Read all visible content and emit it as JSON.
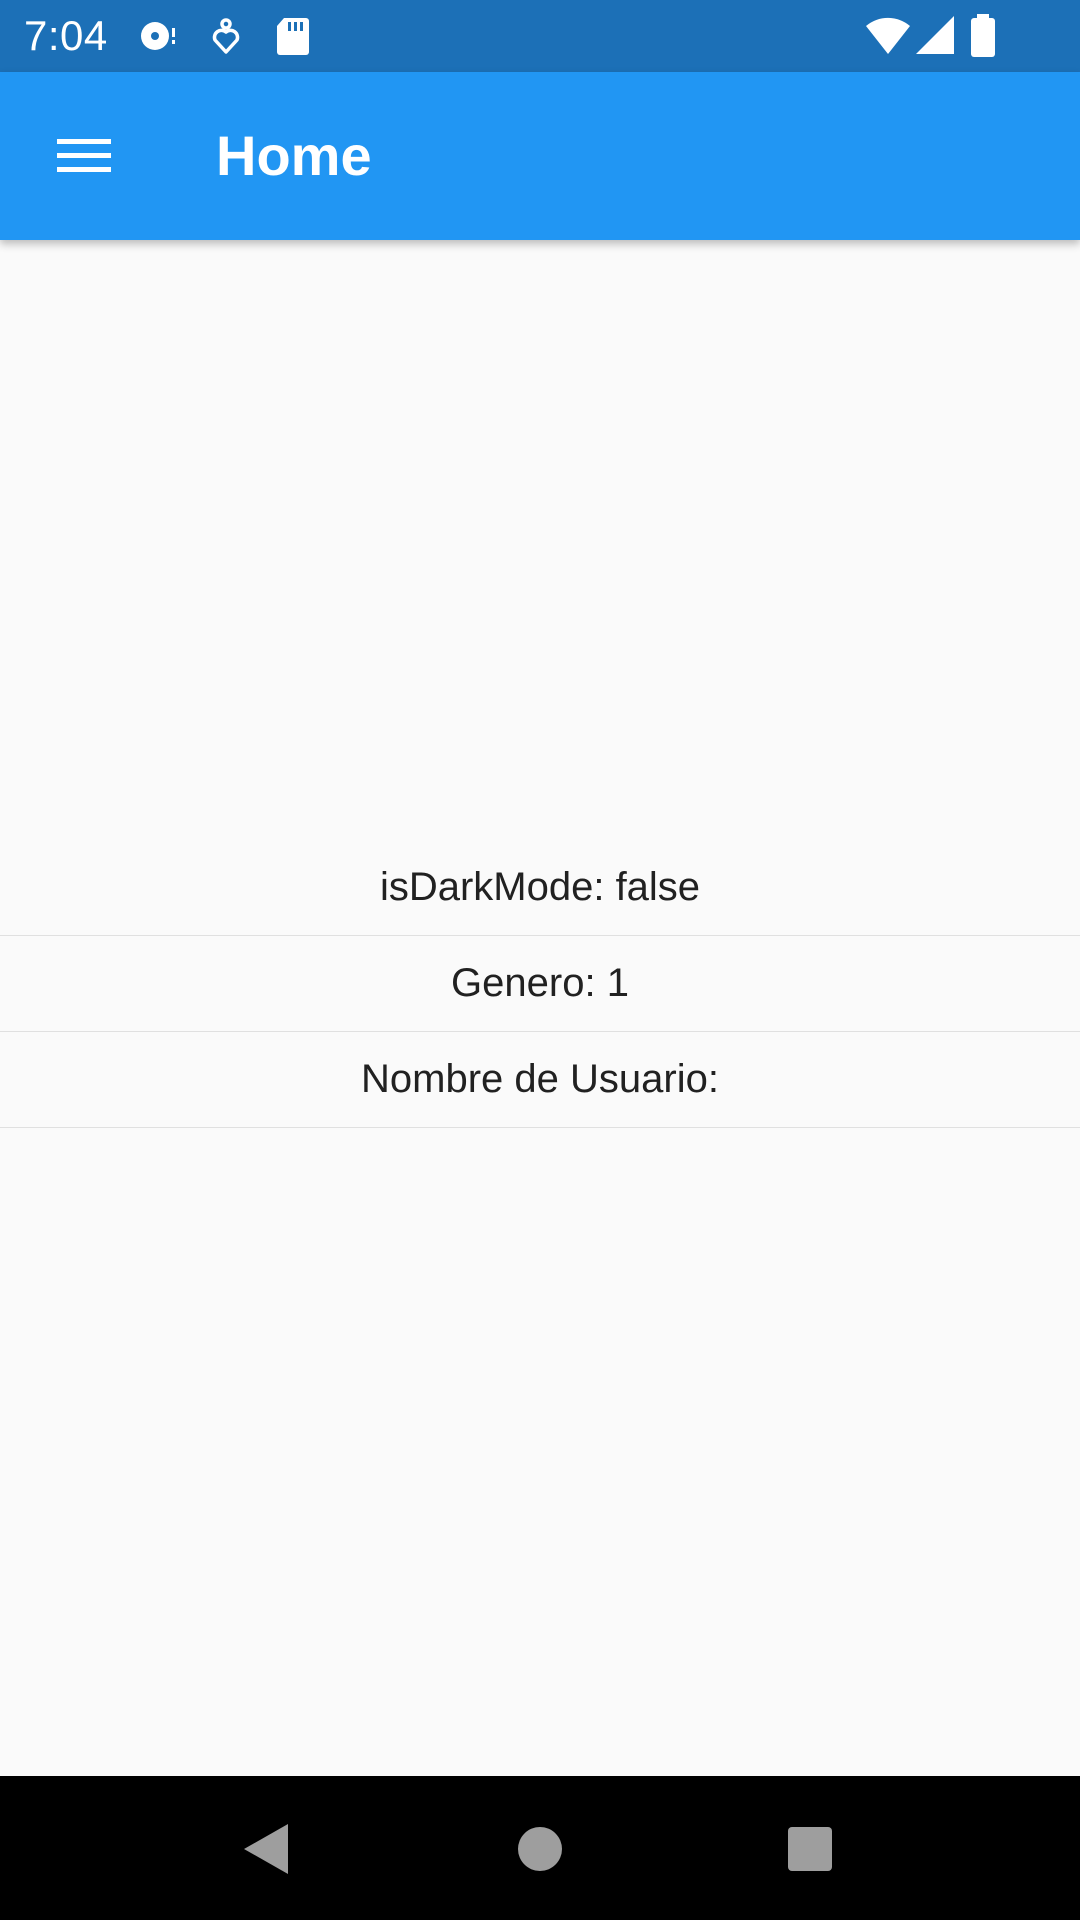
{
  "status_bar": {
    "time": "7:04",
    "icons": [
      "media-disc-icon",
      "location-pin-icon",
      "sd-card-icon",
      "wifi-icon",
      "cell-signal-icon",
      "battery-icon"
    ],
    "background": "#1c70b7"
  },
  "app_bar": {
    "title": "Home",
    "menu_icon": "hamburger-menu-icon",
    "background": "#2196f3"
  },
  "content": {
    "rows": [
      {
        "label": "isDarkMode: false"
      },
      {
        "label": "Genero: 1"
      },
      {
        "label": "Nombre de Usuario:"
      }
    ]
  },
  "nav_bar": {
    "buttons": [
      "back-icon",
      "home-icon",
      "recents-icon"
    ]
  }
}
